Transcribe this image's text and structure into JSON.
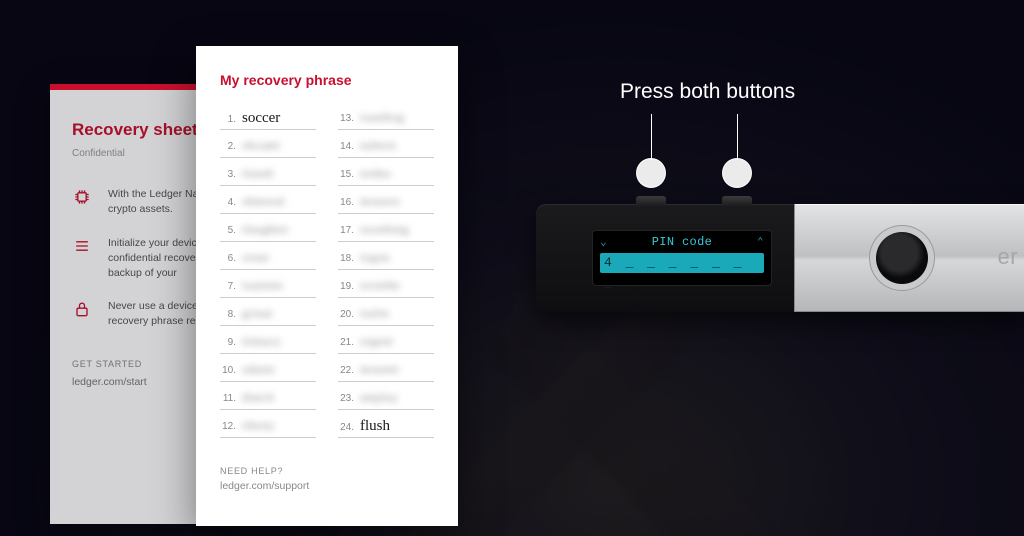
{
  "back_sheet": {
    "title": "Recovery sheet",
    "subtitle": "Confidential",
    "rows": [
      "With the Ledger Nano private keys to securely crypto assets.",
      "Initialize your device to and save your confidential recovery phrase. Your is the only backup of your",
      "Never use a device supplied code or a recovery phrase recovery sheet(s) in a safe"
    ],
    "footer_label": "GET STARTED",
    "footer_link": "ledger.com/start"
  },
  "front_sheet": {
    "title": "My recovery phrase",
    "words": {
      "1": "soccer",
      "24": "flush"
    },
    "footer_label": "NEED HELP?",
    "footer_link": "ledger.com/support"
  },
  "device": {
    "screen_title": "PIN code",
    "screen_digits": "4 _ _ _ _ _ _ _",
    "brand_fragment": "er"
  },
  "callout": {
    "label": "Press both buttons"
  }
}
